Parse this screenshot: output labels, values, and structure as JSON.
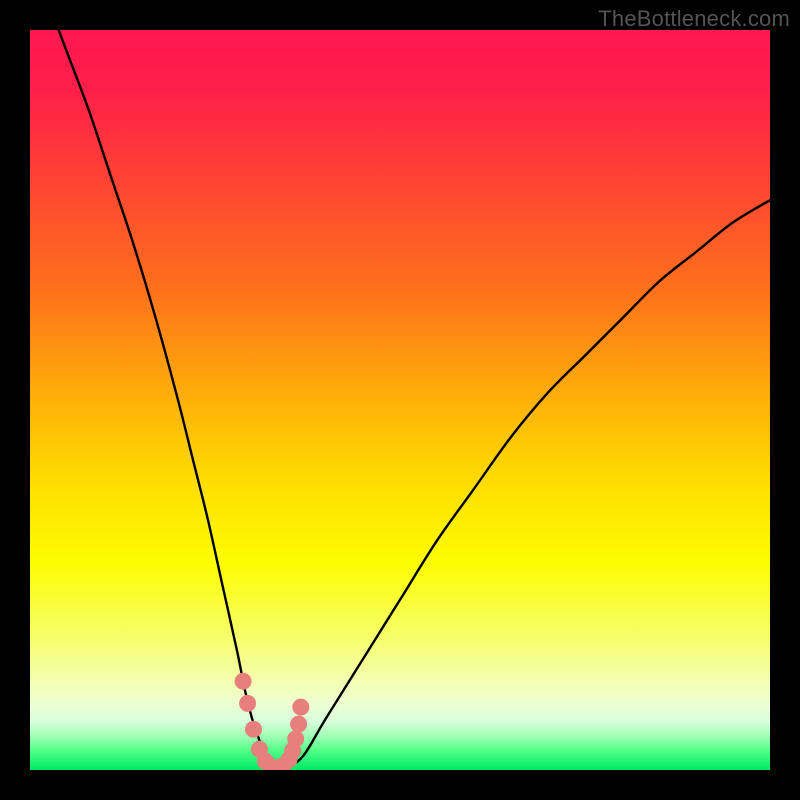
{
  "watermark": "TheBottleneck.com",
  "chart_data": {
    "type": "line",
    "title": "",
    "xlabel": "",
    "ylabel": "",
    "xlim": [
      0,
      100
    ],
    "ylim": [
      0,
      100
    ],
    "series": [
      {
        "name": "bottleneck-curve",
        "x": [
          2,
          5,
          8,
          11,
          14,
          17,
          20,
          22,
          24,
          26,
          28,
          29,
          30,
          31,
          32,
          33,
          34,
          35,
          37,
          40,
          45,
          50,
          55,
          60,
          65,
          70,
          75,
          80,
          85,
          90,
          95,
          100
        ],
        "values": [
          105,
          97,
          89,
          80,
          71,
          61,
          50,
          42,
          34,
          25,
          16,
          11,
          7,
          4,
          1,
          0,
          0,
          0.5,
          2,
          7,
          15,
          23,
          31,
          38,
          45,
          51,
          56,
          61,
          66,
          70,
          74,
          77
        ]
      }
    ],
    "marker_points": {
      "x": [
        28.8,
        29.4,
        30.2,
        31.0,
        31.8,
        32.6,
        33.4,
        34.2,
        35.0,
        35.5,
        35.9,
        36.3,
        36.6
      ],
      "values": [
        12.0,
        9.0,
        5.5,
        2.8,
        1.2,
        0.4,
        0.3,
        0.6,
        1.4,
        2.6,
        4.2,
        6.2,
        8.5
      ],
      "color": "#e77f7d",
      "radius": 8.5
    },
    "gradient_stops": [
      {
        "offset": 0.0,
        "color": "#ff1850"
      },
      {
        "offset": 0.08,
        "color": "#ff1f4a"
      },
      {
        "offset": 0.2,
        "color": "#ff4234"
      },
      {
        "offset": 0.35,
        "color": "#ff701c"
      },
      {
        "offset": 0.5,
        "color": "#ffb108"
      },
      {
        "offset": 0.62,
        "color": "#ffe000"
      },
      {
        "offset": 0.72,
        "color": "#fdfd00"
      },
      {
        "offset": 0.82,
        "color": "#f6ff6a"
      },
      {
        "offset": 0.88,
        "color": "#f3ffb0"
      },
      {
        "offset": 0.91,
        "color": "#eeffd2"
      },
      {
        "offset": 0.935,
        "color": "#d6ffdb"
      },
      {
        "offset": 0.955,
        "color": "#9effb2"
      },
      {
        "offset": 0.975,
        "color": "#4dff85"
      },
      {
        "offset": 1.0,
        "color": "#02e864"
      }
    ]
  }
}
